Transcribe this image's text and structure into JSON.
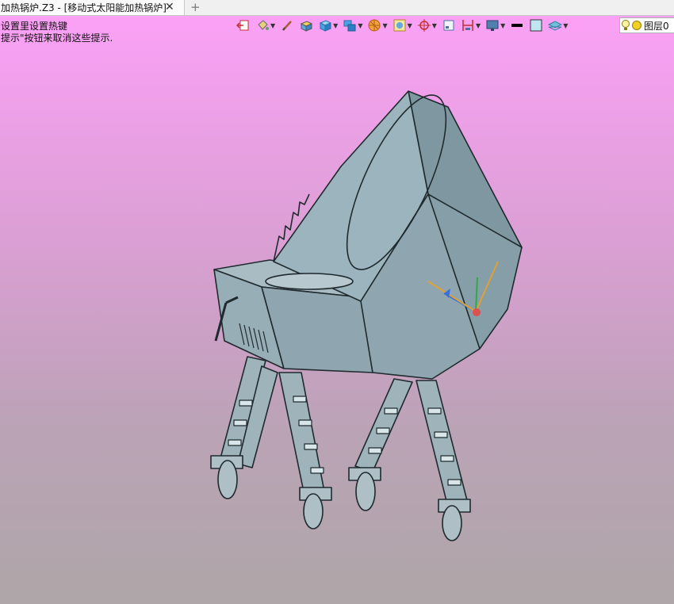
{
  "tab": {
    "title": "加热锅炉.Z3 - [移动式太阳能加热锅炉]",
    "close_glyph": "✕",
    "add_glyph": "+"
  },
  "hints": {
    "line1": "设置里设置热键",
    "line2": "提示\"按钮来取消这些提示."
  },
  "toolbar": {
    "icons": [
      "exit-icon",
      "paint-bucket-icon",
      "pen-icon",
      "box-edit-icon",
      "solid-cube-icon",
      "shaded-cube-icon",
      "render-icon",
      "frame-icon",
      "axis-icon",
      "plane-icon",
      "measure-icon",
      "display-icon",
      "line-color-icon",
      "fill-color-icon",
      "layer-stack-icon"
    ],
    "line_color": "#000000",
    "fill_color": "#bfe6f0",
    "layer_label": "图层0"
  },
  "colors": {
    "viewport_top": "#fba1f6",
    "viewport_bottom": "#aea6a8",
    "model_fill": "#8fa6b0"
  }
}
